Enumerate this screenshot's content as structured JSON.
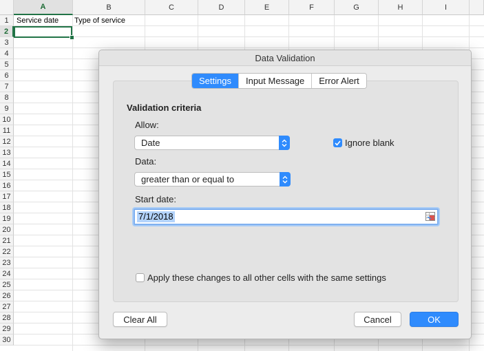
{
  "spreadsheet": {
    "columns": [
      "A",
      "B",
      "C",
      "D",
      "E",
      "F",
      "G",
      "H",
      "I"
    ],
    "active_column": "A",
    "rows": [
      "1",
      "2",
      "3",
      "4",
      "5",
      "6",
      "7",
      "8",
      "9",
      "10",
      "11",
      "12",
      "13",
      "14",
      "15",
      "16",
      "17",
      "18",
      "19",
      "20",
      "21",
      "22",
      "23",
      "24",
      "25",
      "26",
      "27",
      "28",
      "29",
      "30"
    ],
    "active_row": "2",
    "cells": {
      "A1": "Service date",
      "B1": "Type of service"
    }
  },
  "dialog": {
    "title": "Data Validation",
    "tabs": [
      {
        "label": "Settings",
        "active": true
      },
      {
        "label": "Input Message",
        "active": false
      },
      {
        "label": "Error Alert",
        "active": false
      }
    ],
    "section_title": "Validation criteria",
    "allow_label": "Allow:",
    "allow_value": "Date",
    "ignore_blank_label": "Ignore blank",
    "ignore_blank_checked": true,
    "data_label": "Data:",
    "data_value": "greater than or equal to",
    "start_date_label": "Start date:",
    "start_date_value": "7/1/2018",
    "apply_all_label": "Apply these changes to all other cells with the same settings",
    "apply_all_checked": false,
    "clear_all_label": "Clear All",
    "cancel_label": "Cancel",
    "ok_label": "OK"
  },
  "colors": {
    "accent": "#2f8bfd",
    "selection_green": "#217346"
  }
}
